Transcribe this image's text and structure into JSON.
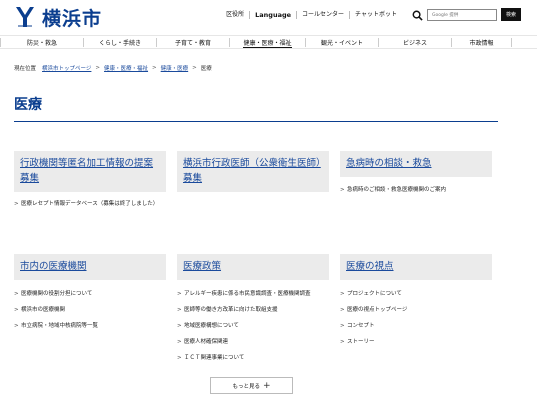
{
  "header": {
    "logo_text": "横浜市",
    "utility_links": [
      "区役所",
      "Language",
      "コールセンター",
      "チャットボット"
    ],
    "search": {
      "placeholder": "Google 提供",
      "button_label": "検索"
    }
  },
  "gnav": {
    "items": [
      "防災・救急",
      "くらし・手続き",
      "子育て・教育",
      "健康・医療・福祉",
      "観光・イベント",
      "ビジネス",
      "市政情報"
    ],
    "active_index": 3
  },
  "breadcrumb": {
    "current_label": "現在位置",
    "items": [
      "横浜市トップページ",
      "健康・医療・福祉",
      "健康・医療",
      "医療"
    ]
  },
  "page_title": "医療",
  "cards": [
    {
      "title": "行政機関等匿名加工情報の提案募集",
      "items": [
        "医療レセプト情報データベース（募集は終了しました）"
      ]
    },
    {
      "title": "横浜市行政医師（公衆衛生医師）募集",
      "items": []
    },
    {
      "title": "急病時の相談・救急",
      "items": [
        "急病時のご相談・救急医療機関のご案内"
      ]
    },
    {
      "title": "市内の医療機関",
      "items": [
        "医療機関の役割分担について",
        "横浜市の医療機関",
        "市立病院・地域中核病院等一覧"
      ]
    },
    {
      "title": "医療政策",
      "items": [
        "アレルギー疾患に係る市民意識調査・医療機関調査",
        "医師等の働き方改革に向けた取組支援",
        "地域医療構想について",
        "医療人材確保関連",
        "ＩＣＴ関連事業について"
      ]
    },
    {
      "title": "医療の視点",
      "items": [
        "プロジェクトについて",
        "医療の視点トップページ",
        "コンセプト",
        "ストーリー"
      ]
    }
  ],
  "more_button": {
    "label": "もっと見る",
    "icon": "plus-icon"
  },
  "colors": {
    "brand": "#0b3e8f",
    "link": "#1a4a9c",
    "card_bg": "#ebebeb"
  }
}
